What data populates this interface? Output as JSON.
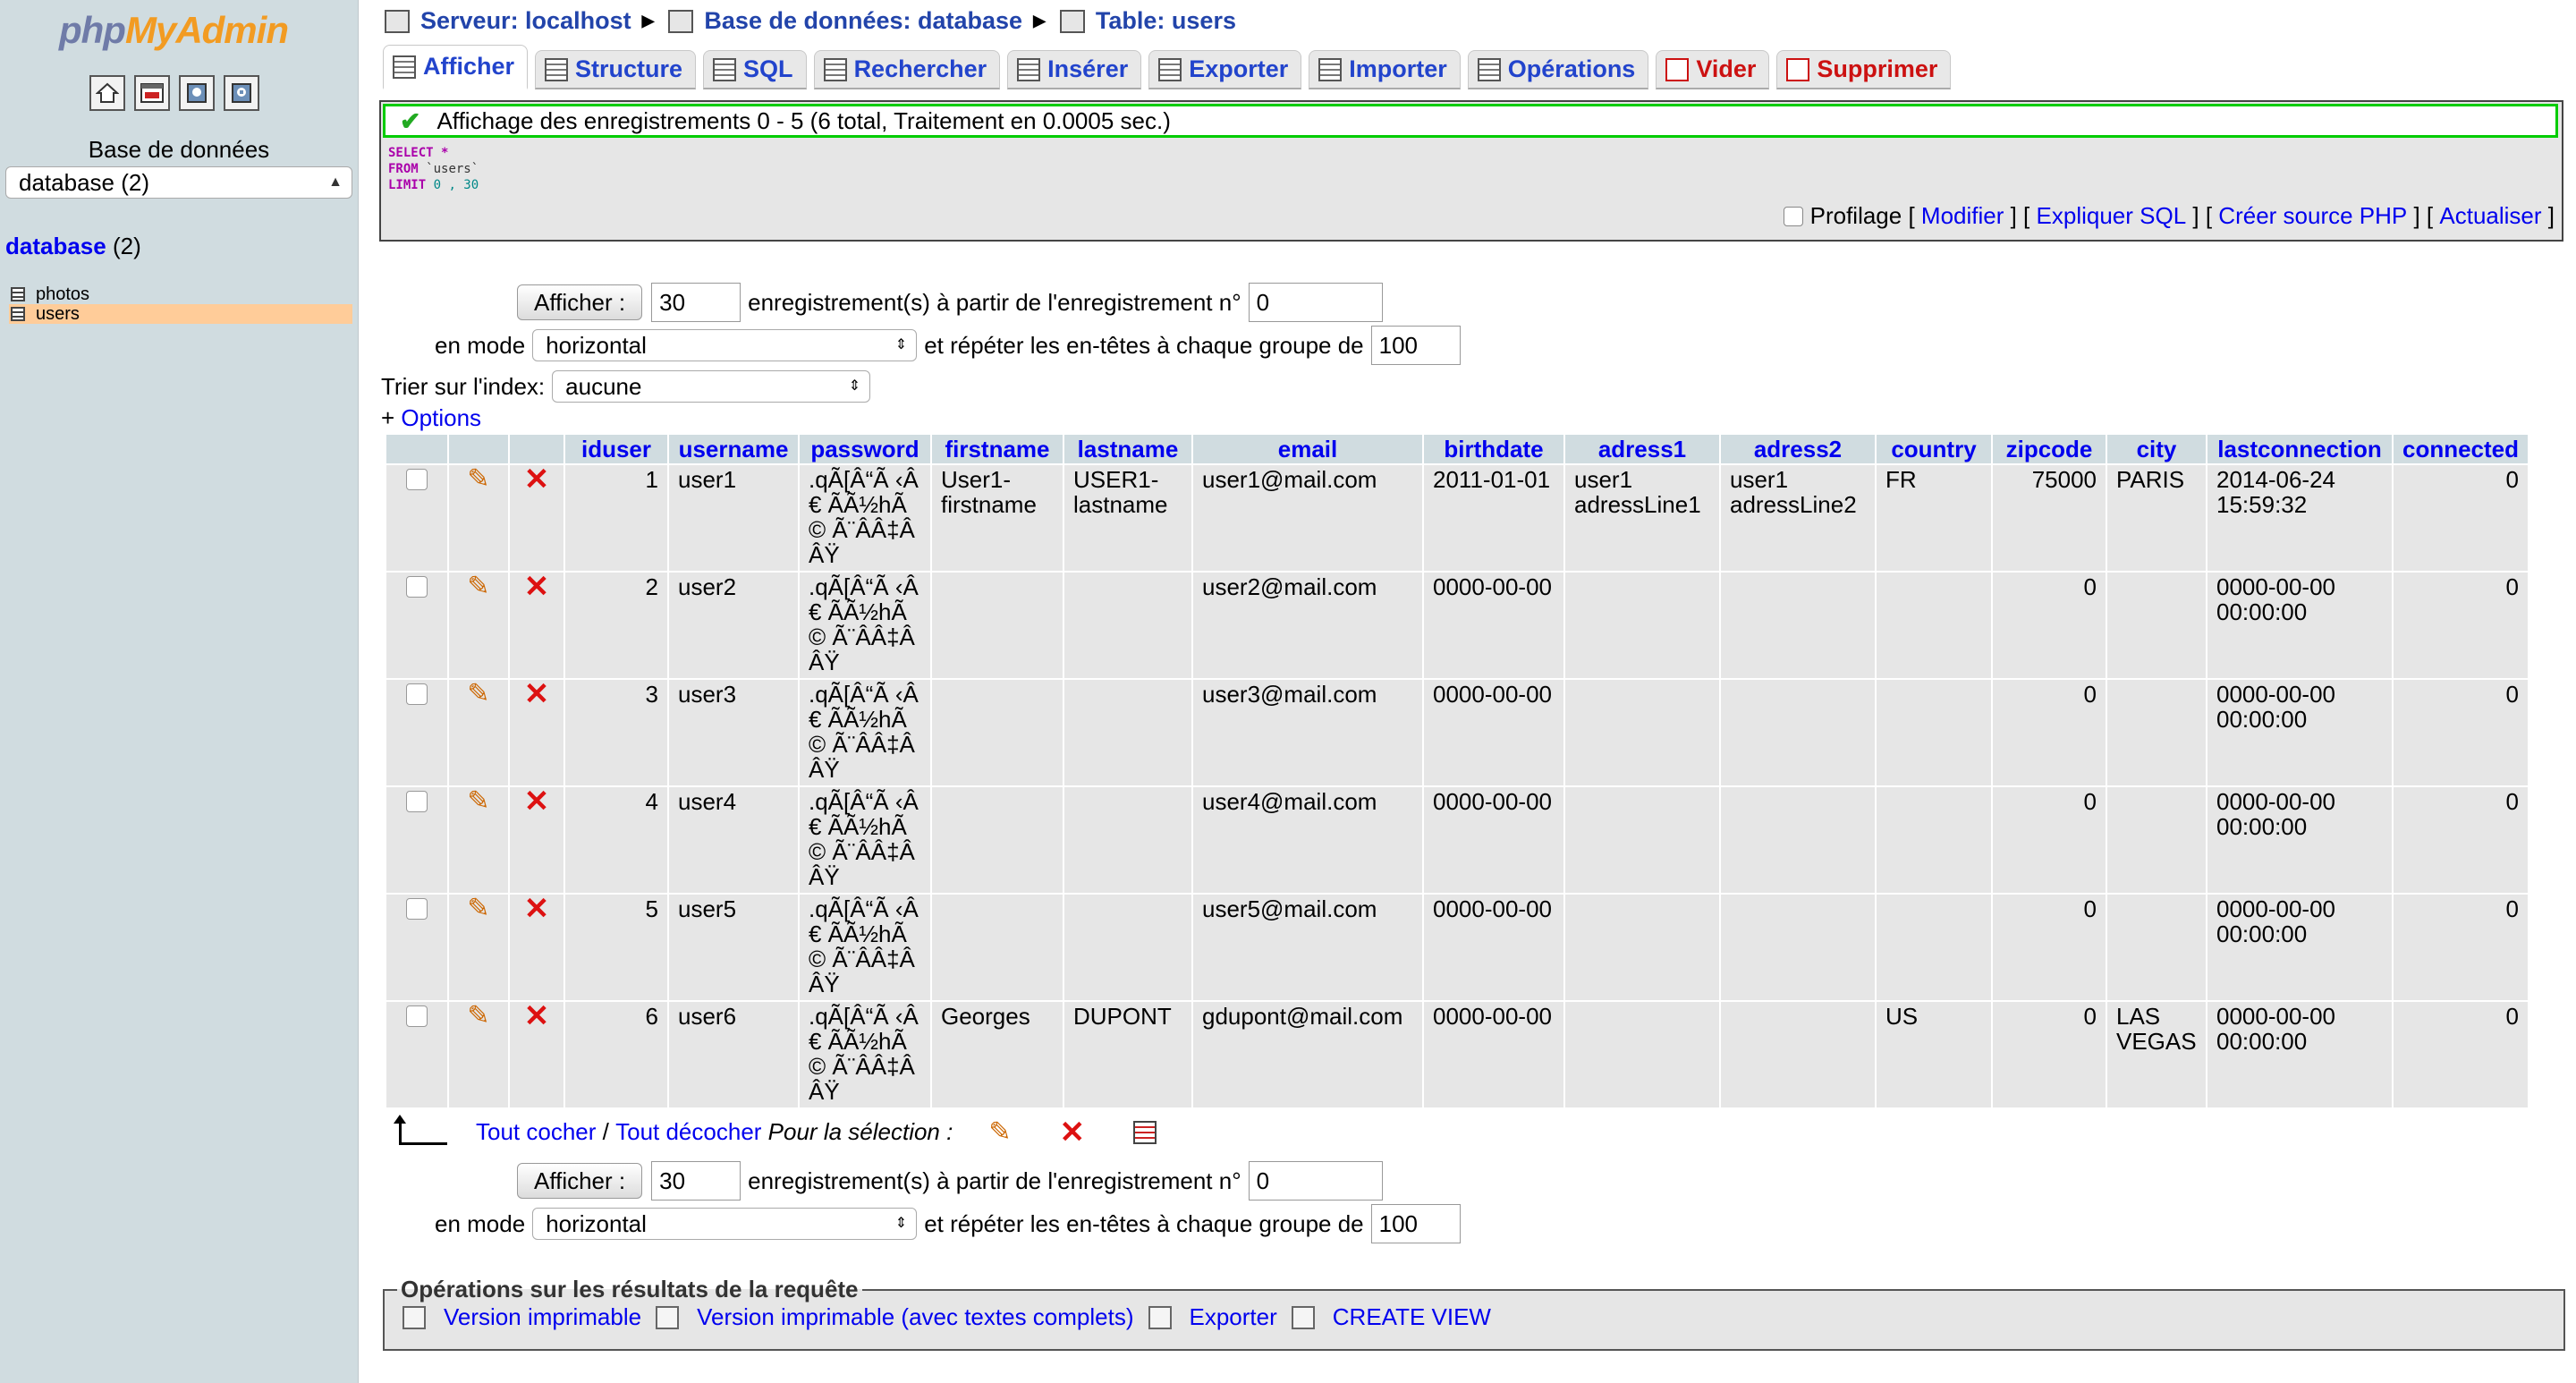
{
  "sidebar": {
    "logo_php": "php",
    "logo_myadmin": "MyAdmin",
    "db_label": "Base de données",
    "db_select_value": "database (2)",
    "db_title_link": "database",
    "db_title_count": "(2)",
    "tables": [
      {
        "name": "photos",
        "active": false
      },
      {
        "name": "users",
        "active": true
      }
    ]
  },
  "breadcrumb": {
    "server": "Serveur: localhost",
    "database": "Base de données: database",
    "table": "Table: users"
  },
  "tabs": [
    {
      "label": "Afficher",
      "active": true,
      "danger": false
    },
    {
      "label": "Structure",
      "active": false,
      "danger": false
    },
    {
      "label": "SQL",
      "active": false,
      "danger": false
    },
    {
      "label": "Rechercher",
      "active": false,
      "danger": false
    },
    {
      "label": "Insérer",
      "active": false,
      "danger": false
    },
    {
      "label": "Exporter",
      "active": false,
      "danger": false
    },
    {
      "label": "Importer",
      "active": false,
      "danger": false
    },
    {
      "label": "Opérations",
      "active": false,
      "danger": false
    },
    {
      "label": "Vider",
      "active": false,
      "danger": true
    },
    {
      "label": "Supprimer",
      "active": false,
      "danger": true
    }
  ],
  "result": {
    "message": "Affichage des enregistrements 0 - 5 (6 total, Traitement en 0.0005 sec.)",
    "sql": {
      "select_kw": "SELECT",
      "select_val": "*",
      "from_kw": "FROM",
      "from_val": "`users`",
      "limit_kw": "LIMIT",
      "limit_val": "0 , 30"
    },
    "profiling_label": "Profilage",
    "links": [
      "Modifier",
      "Expliquer SQL",
      "Créer source PHP",
      "Actualiser"
    ]
  },
  "navigation": {
    "show_button": "Afficher :",
    "rows_value": "30",
    "rows_text": "enregistrement(s) à partir de l'enregistrement n°",
    "start_value": "0",
    "mode_label": "en mode",
    "mode_value": "horizontal",
    "repeat_text": "et répéter les en-têtes à chaque groupe de",
    "repeat_value": "100",
    "sort_label": "Trier sur l'index:",
    "sort_value": "aucune",
    "options_prefix": "+",
    "options_link": "Options"
  },
  "table": {
    "columns": [
      "iduser",
      "username",
      "password",
      "firstname",
      "lastname",
      "email",
      "birthdate",
      "adress1",
      "adress2",
      "country",
      "zipcode",
      "city",
      "lastconnection",
      "connected"
    ],
    "rows": [
      {
        "iduser": "1",
        "username": "user1",
        "password": ".qÃ[Â“Ã ‹Â€ ÃÃ½hÃ© Ã¨ÂÂ‡ÂÂŸ",
        "firstname": "User1-firstname",
        "lastname": "USER1-lastname",
        "email": "user1@mail.com",
        "birthdate": "2011-01-01",
        "adress1": "user1 adressLine1",
        "adress2": "user1 adressLine2",
        "country": "FR",
        "zipcode": "75000",
        "city": "PARIS",
        "lastconnection": "2014-06-24 15:59:32",
        "connected": "0"
      },
      {
        "iduser": "2",
        "username": "user2",
        "password": ".qÃ[Â“Ã ‹Â€ ÃÃ½hÃ© Ã¨ÂÂ‡ÂÂŸ",
        "firstname": "",
        "lastname": "",
        "email": "user2@mail.com",
        "birthdate": "0000-00-00",
        "adress1": "",
        "adress2": "",
        "country": "",
        "zipcode": "0",
        "city": "",
        "lastconnection": "0000-00-00 00:00:00",
        "connected": "0"
      },
      {
        "iduser": "3",
        "username": "user3",
        "password": ".qÃ[Â“Ã ‹Â€ ÃÃ½hÃ© Ã¨ÂÂ‡ÂÂŸ",
        "firstname": "",
        "lastname": "",
        "email": "user3@mail.com",
        "birthdate": "0000-00-00",
        "adress1": "",
        "adress2": "",
        "country": "",
        "zipcode": "0",
        "city": "",
        "lastconnection": "0000-00-00 00:00:00",
        "connected": "0"
      },
      {
        "iduser": "4",
        "username": "user4",
        "password": ".qÃ[Â“Ã ‹Â€ ÃÃ½hÃ© Ã¨ÂÂ‡ÂÂŸ",
        "firstname": "",
        "lastname": "",
        "email": "user4@mail.com",
        "birthdate": "0000-00-00",
        "adress1": "",
        "adress2": "",
        "country": "",
        "zipcode": "0",
        "city": "",
        "lastconnection": "0000-00-00 00:00:00",
        "connected": "0"
      },
      {
        "iduser": "5",
        "username": "user5",
        "password": ".qÃ[Â“Ã ‹Â€ ÃÃ½hÃ© Ã¨ÂÂ‡ÂÂŸ",
        "firstname": "",
        "lastname": "",
        "email": "user5@mail.com",
        "birthdate": "0000-00-00",
        "adress1": "",
        "adress2": "",
        "country": "",
        "zipcode": "0",
        "city": "",
        "lastconnection": "0000-00-00 00:00:00",
        "connected": "0"
      },
      {
        "iduser": "6",
        "username": "user6",
        "password": ".qÃ[Â“Ã ‹Â€ ÃÃ½hÃ© Ã¨ÂÂ‡ÂÂŸ",
        "firstname": "Georges",
        "lastname": "DUPONT",
        "email": "gdupont@mail.com",
        "birthdate": "0000-00-00",
        "adress1": "",
        "adress2": "",
        "country": "US",
        "zipcode": "0",
        "city": "LAS VEGAS",
        "lastconnection": "0000-00-00 00:00:00",
        "connected": "0"
      }
    ]
  },
  "selection": {
    "check_all": "Tout cocher",
    "separator": "/",
    "uncheck_all": "Tout décocher",
    "for_selection": "Pour la sélection :"
  },
  "operations": {
    "legend": "Opérations sur les résultats de la requête",
    "links": [
      "Version imprimable",
      "Version imprimable (avec textes complets)",
      "Exporter",
      "CREATE VIEW"
    ]
  },
  "icons": {
    "success": "check-icon",
    "edit": "pencil-icon",
    "delete": "x-icon"
  },
  "colors": {
    "sidebar_bg": "#d0dce0",
    "header_bg": "#d0dce0",
    "row_bg": "#e6e6e6",
    "link": "#0000ee",
    "success_border": "#00cc00",
    "danger": "#cc1111",
    "highlight": "#ffcc99"
  }
}
